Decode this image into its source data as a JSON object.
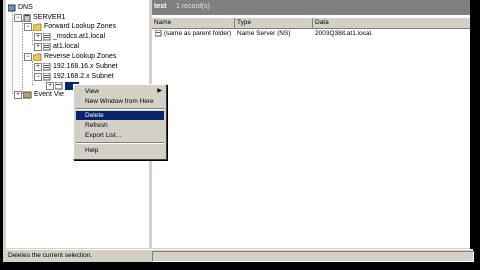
{
  "tree": {
    "root": "DNS",
    "server": "SERVER1",
    "forward_zones": "Forward Lookup Zones",
    "forward_items": [
      "_msdcs.at1.local",
      "at1.local"
    ],
    "reverse_zones": "Reverse Lookup Zones",
    "reverse_items": [
      "192.168.16.x Subnet",
      "192.168.2.x Subnet"
    ],
    "selected_child": "",
    "event_viewer": "Event Vie"
  },
  "right_pane": {
    "title": "test",
    "count": "1 record(s)",
    "columns": [
      "Name",
      "Type",
      "Data"
    ],
    "rows": [
      {
        "name": "(same as parent folder)",
        "type": "Name Server (NS)",
        "data": "2003Q38it.at1.local."
      }
    ]
  },
  "context_menu": {
    "items": [
      {
        "label": "View",
        "submenu": true
      },
      {
        "label": "New Window from Here",
        "submenu": false
      },
      {
        "label": "Delete",
        "submenu": false
      },
      {
        "label": "Refresh",
        "submenu": false
      },
      {
        "label": "Export List...",
        "submenu": false
      },
      {
        "label": "Help",
        "submenu": false
      }
    ],
    "selected": "Delete"
  },
  "status": {
    "text": "Deletes the current selection."
  },
  "colors": {
    "selection": "#0a246a",
    "header": "#808080",
    "face": "#d4d0c8"
  }
}
